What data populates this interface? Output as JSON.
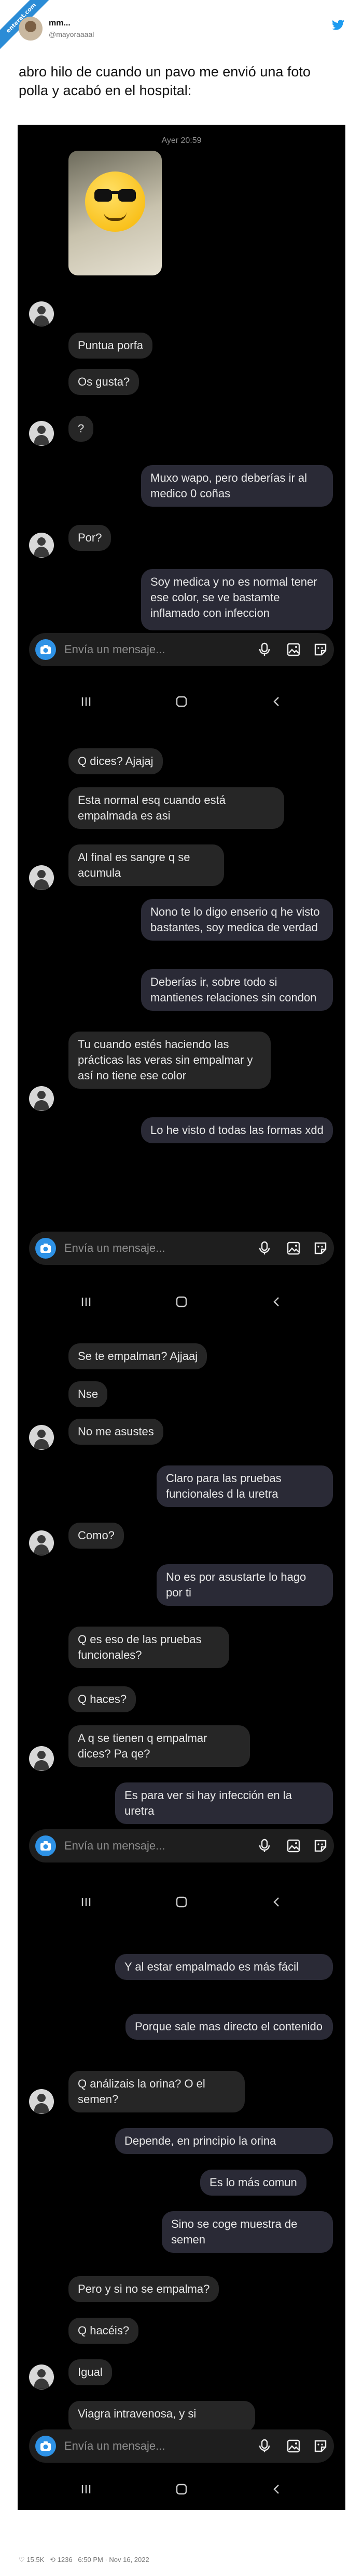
{
  "badge": "enterat.com",
  "tweet": {
    "author_name": "mm...",
    "author_handle": "@mayoraaaal",
    "text": "abro hilo de cuando un pavo me envió una foto polla y acabó en el hospital:"
  },
  "chat": {
    "timestamp": "Ayer 20:59",
    "compose_placeholder": "Envía un mensaje...",
    "messages": [
      {
        "from": "out_label",
        "text": ""
      },
      {
        "text": "Puntua porfa"
      },
      {
        "text": "Os gusta?"
      },
      {
        "text": "?"
      },
      {
        "text": "Muxo wapo, pero deberías ir al medico 0 coñas"
      },
      {
        "text": "Por?"
      },
      {
        "text": "Soy medica y no es normal tener ese color, se ve bastamte inflamado con infeccion"
      },
      {
        "text": "Q dices? Ajajaj"
      },
      {
        "text": "Esta normal esq cuando está empalmada es asi"
      },
      {
        "text": "Al final es sangre q se acumula"
      },
      {
        "text": "Nono te lo digo enserio q he visto bastantes, soy medica de verdad"
      },
      {
        "text": "Deberías ir, sobre todo si mantienes relaciones sin condon"
      },
      {
        "text": "Tu cuando estés haciendo las prácticas las veras sin empalmar y así no tiene ese color"
      },
      {
        "text": "Lo he visto d todas las formas xdd"
      },
      {
        "text": "Se te empalman? Ajjaaj"
      },
      {
        "text": "Nse"
      },
      {
        "text": "No me asustes"
      },
      {
        "text": "Claro para las pruebas funcionales d la uretra"
      },
      {
        "text": "Como?"
      },
      {
        "text": "No es por asustarte lo hago por ti"
      },
      {
        "text": "Q es eso de las pruebas funcionales?"
      },
      {
        "text": "Q haces?"
      },
      {
        "text": "A q se tienen q empalmar dices? Pa qe?"
      },
      {
        "text": "Es para ver si hay infección en la uretra"
      },
      {
        "text": "Y al estar empalmado es más fácil"
      },
      {
        "text": "Porque sale mas directo el contenido"
      },
      {
        "text": "Q análizais la orina? O el semen?"
      },
      {
        "text": "Depende, en principio la orina"
      },
      {
        "text": "Es lo más comun"
      },
      {
        "text": "Sino se coge muestra de semen"
      },
      {
        "text": "Pero y si no se empalma?"
      },
      {
        "text": "Q hacéis?"
      },
      {
        "text": "Igual"
      },
      {
        "text": "Viagra intravenosa, y si"
      }
    ]
  },
  "footer": {
    "likes": "15.5K",
    "retweets": "1236",
    "time": "6:50 PM · Nov 16, 2022"
  },
  "colors": {
    "background": "#000000",
    "bubble_in": "#262626",
    "bubble_out": "#2a2a36",
    "accent": "#2e92e6"
  }
}
